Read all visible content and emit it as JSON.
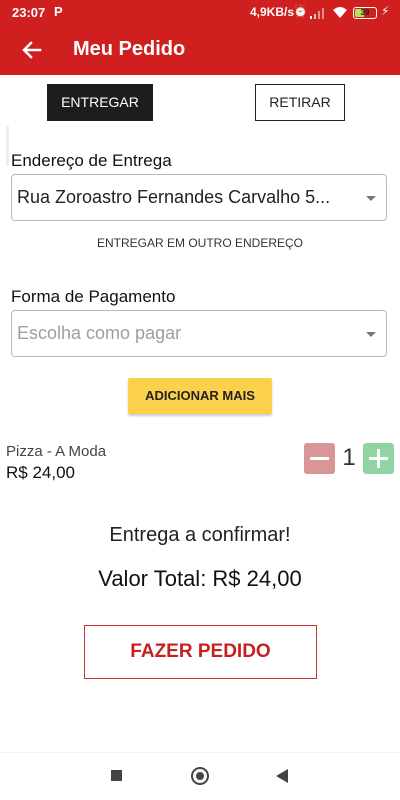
{
  "status_bar": {
    "time": "23:07",
    "notification_letter": "P",
    "network_speed": "4,9KB/s",
    "battery_level": "39",
    "icons": [
      "p-notification-icon",
      "alarm-icon",
      "signal-icon",
      "wifi-icon",
      "battery-icon",
      "charging-icon"
    ]
  },
  "app_bar": {
    "title": "Meu Pedido",
    "back_icon": "arrow-left-icon",
    "background": "#cf1f1f"
  },
  "delivery_toggle": {
    "deliver_label": "ENTREGAR",
    "pickup_label": "RETIRAR",
    "selected": "ENTREGAR"
  },
  "address": {
    "label": "Endereço de Entrega",
    "value": "Rua Zoroastro Fernandes Carvalho 5...",
    "other_address_link": "ENTREGAR EM OUTRO ENDEREÇO"
  },
  "payment": {
    "label": "Forma de Pagamento",
    "placeholder": "Escolha como pagar"
  },
  "add_more_label": "ADICIONAR MAIS",
  "cart_items": [
    {
      "name": "Pizza - A Moda",
      "price": "R$ 24,00",
      "quantity": "1"
    }
  ],
  "delivery_status": "Entrega a confirmar!",
  "total_text": "Valor Total: R$ 24,00",
  "order_button_label": "FAZER PEDIDO",
  "colors": {
    "primary": "#cf1f1f",
    "dark_button": "#1d1d1d",
    "add_button": "#fbd14b",
    "minus_button": "#d99697",
    "plus_button": "#8fd4a2"
  }
}
